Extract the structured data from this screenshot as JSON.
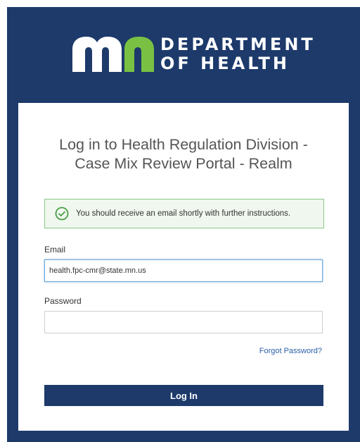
{
  "brand": {
    "logo": "mn-logo",
    "line1": "DEPARTMENT",
    "line2": "OF HEALTH",
    "colors": {
      "navy": "#1d3a6b",
      "logo_green": "#7ac143",
      "logo_white": "#ffffff"
    }
  },
  "login": {
    "title_line1": "Log in to Health Regulation Division -",
    "title_line2": "Case Mix Review Portal - Realm",
    "alert": {
      "icon": "check-circle-icon",
      "message": "You should receive an email shortly with further instructions.",
      "color": "#8dc58a"
    },
    "email_label": "Email",
    "email_value": "health.fpc-cmr@state.mn.us",
    "password_label": "Password",
    "password_value": "",
    "forgot_link": "Forgot Password?",
    "submit_label": "Log In"
  }
}
